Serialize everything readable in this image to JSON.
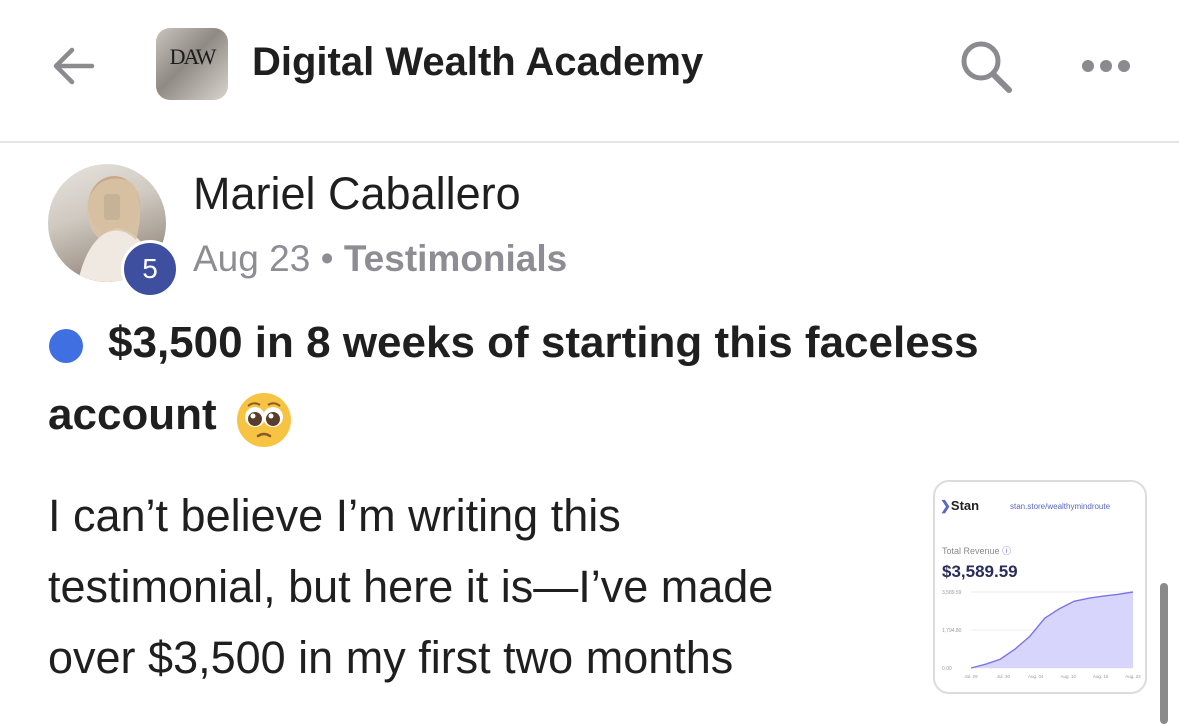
{
  "header": {
    "group_name": "Digital Wealth Academy",
    "logo_text": "DAW",
    "back_icon": "arrow-left-icon",
    "search_icon": "search-icon",
    "more_icon": "more-horizontal-icon"
  },
  "post": {
    "author": "Mariel Caballero",
    "author_level": "5",
    "date": "Aug 23",
    "separator": "•",
    "category": "Testimonials",
    "title_line1": "$3,500 in 8 weeks of starting this faceless",
    "title_line2": "account",
    "title_emoji": "pleading-face-emoji",
    "body_lines": [
      "I can’t believe I’m writing this",
      "testimonial, but here it is—I’ve made",
      "over $3,500 in my first two months"
    ],
    "accent_color": "#3f6fe0"
  },
  "attachment": {
    "brand": "Stan",
    "url": "stan.store/wealthymindroute",
    "label": "Total Revenue",
    "value": "$3,589.59",
    "chart_data": {
      "type": "area",
      "x": [
        "Jul. 29",
        "Jul. 30",
        "Aug. 04",
        "Aug. 10",
        "Aug. 16",
        "Aug. 22"
      ],
      "y_ticks": [
        "3,589.59",
        "1,794.80",
        "0.00"
      ],
      "ylim": [
        0,
        3589.59
      ],
      "values": [
        0,
        180,
        420,
        900,
        1500,
        2350,
        2800,
        3150,
        3300,
        3400,
        3480,
        3589.59
      ]
    }
  }
}
